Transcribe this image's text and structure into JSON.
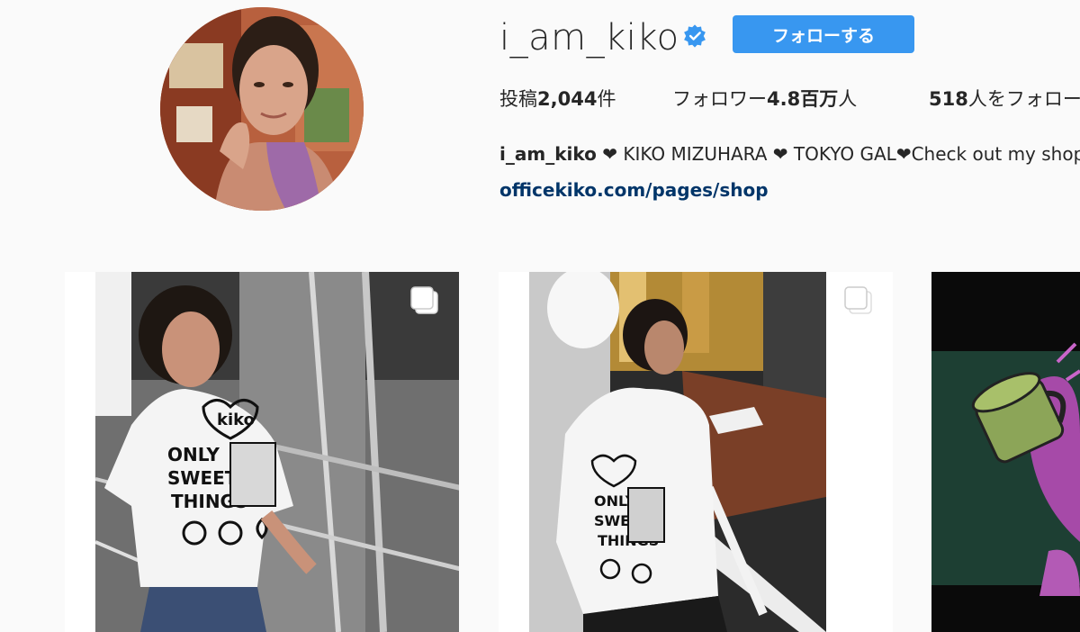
{
  "profile": {
    "username": "i_am_kiko",
    "follow_label": "フォローする",
    "avatar": "profile-photo"
  },
  "stats": {
    "posts_prefix": "投稿",
    "posts_count": "2,044",
    "posts_suffix": "件",
    "followers_prefix": "フォロワー",
    "followers_count": "4.8百万",
    "followers_suffix": "人",
    "following_count": "518",
    "following_suffix": "人をフォロー中"
  },
  "bio": {
    "name": "i_am_kiko",
    "text": " ❤ KIKO MIZUHARA ❤ TOKYO GAL❤Check out my shop",
    "link": "officekiko.com/pages/shop"
  },
  "colors": {
    "accent": "#3897f0",
    "link": "#003569",
    "verified": "#3897f0",
    "background": "#fafafa"
  },
  "posts": [
    {
      "icon": "multiple-posts-icon",
      "subject": "woman in printed white t-shirt on staircase"
    },
    {
      "icon": "multiple-posts-icon",
      "subject": "woman in printed white jacket on street"
    },
    {
      "icon": "none",
      "subject": "illustration with green cup and purple figure"
    }
  ]
}
